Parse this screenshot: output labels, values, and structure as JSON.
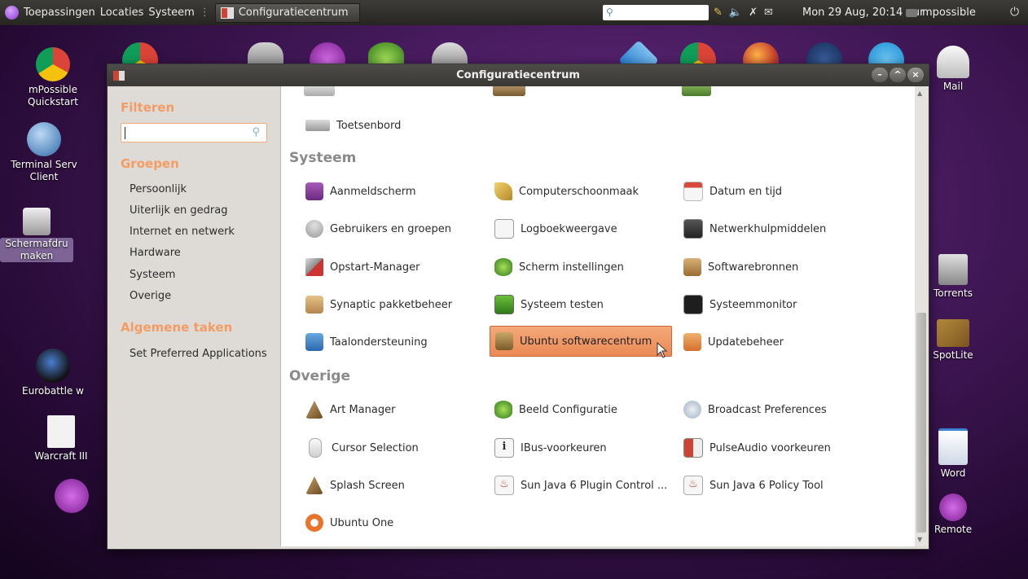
{
  "top_panel": {
    "menus": [
      "Toepassingen",
      "Locaties",
      "Systeem"
    ],
    "task_button": "Configuratiecentrum",
    "clock": "Mon 29 Aug, 20:14 uur",
    "user": "mpossible"
  },
  "desktop_left": [
    {
      "label": "mPossible Quickstart"
    },
    {
      "label": "Terminal Serv Client"
    },
    {
      "label": "Schermafdru maken"
    },
    {
      "label": "Eurobattle w"
    },
    {
      "label": "Warcraft III"
    }
  ],
  "desktop_right": [
    {
      "label": "Mail"
    },
    {
      "label": "Torrents"
    },
    {
      "label": "SpotLite"
    },
    {
      "label": "Word"
    },
    {
      "label": "Remote"
    }
  ],
  "window": {
    "title": "Configuratiecentrum",
    "sidebar": {
      "filter_heading": "Filteren",
      "groups_heading": "Groepen",
      "groups": [
        "Persoonlijk",
        "Uiterlijk en gedrag",
        "Internet en netwerk",
        "Hardware",
        "Systeem",
        "Overige"
      ],
      "tasks_heading": "Algemene taken",
      "tasks": [
        "Set Preferred Applications"
      ]
    },
    "content": {
      "prev_item": "Toetsenbord",
      "sections": [
        {
          "title": "Systeem",
          "items": [
            "Aanmeldscherm",
            "Computerschoonmaak",
            "Datum en tijd",
            "Gebruikers en groepen",
            "Logboekweergave",
            "Netwerkhulpmiddelen",
            "Opstart-Manager",
            "Scherm instellingen",
            "Softwarebronnen",
            "Synaptic pakketbeheer",
            "Systeem testen",
            "Systeemmonitor",
            "Taalondersteuning",
            "Ubuntu softwarecentrum",
            "Updatebeheer"
          ]
        },
        {
          "title": "Overige",
          "items": [
            "Art Manager",
            "Beeld Configuratie",
            "Broadcast Preferences",
            "Cursor Selection",
            "IBus-voorkeuren",
            "PulseAudio voorkeuren",
            "Splash Screen",
            "Sun Java 6 Plugin Control ...",
            "Sun Java 6 Policy Tool",
            "Ubuntu One"
          ]
        }
      ],
      "highlighted_item": "Ubuntu softwarecentrum"
    }
  },
  "colors": {
    "accent": "#f39c64",
    "highlight": "#ea8a55",
    "desktop": "#44195a"
  }
}
